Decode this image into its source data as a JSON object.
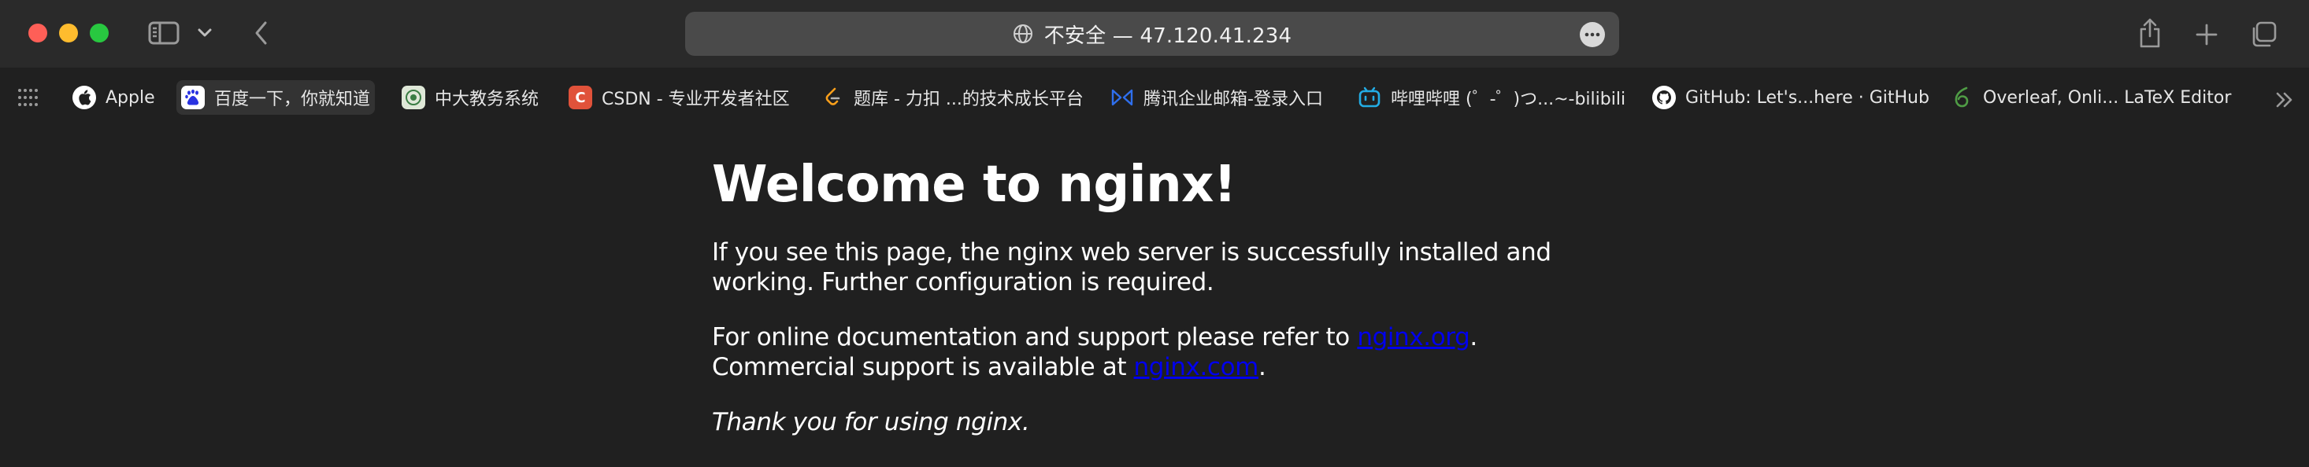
{
  "browser": {
    "address": "不安全 — 47.120.41.234"
  },
  "bookmarks": [
    {
      "label": "Apple",
      "icon": "apple-icon",
      "color": "#ffffff"
    },
    {
      "label": "百度一下，你就知道",
      "icon": "baidu-icon",
      "color": "#2932e1"
    },
    {
      "label": "中大教务系统",
      "icon": "sysu-icon",
      "color": "#3a7d44"
    },
    {
      "label": "CSDN - 专业开发者社区",
      "icon": "csdn-icon",
      "color": "#e0523a"
    },
    {
      "label": "题库 - 力扣 ...的技术成长平台",
      "icon": "leetcode-icon",
      "color": "#f89f1b"
    },
    {
      "label": "腾讯企业邮箱-登录入口",
      "icon": "tencent-mail-icon",
      "color": "#2f6fed"
    },
    {
      "label": "哔哩哔哩 (゜-゜)つ...~-bilibili",
      "icon": "bilibili-icon",
      "color": "#23ade5"
    },
    {
      "label": "GitHub: Let's...here · GitHub",
      "icon": "github-icon",
      "color": "#ffffff"
    },
    {
      "label": "Overleaf, Onli... LaTeX Editor",
      "icon": "overleaf-icon",
      "color": "#4f9c45"
    }
  ],
  "page": {
    "title": "Welcome to nginx!",
    "p1": "If you see this page, the nginx web server is successfully installed and working. Further configuration is required.",
    "p2_before": "For online documentation and support please refer to ",
    "p2_link": "nginx.org",
    "p2_mid": ".",
    "p2_line2": "Commercial support is available at ",
    "p2_link2": "nginx.com",
    "p2_end": ".",
    "p3": "Thank you for using nginx."
  },
  "colors": {
    "background": "#202020",
    "link": "#0000ee"
  }
}
